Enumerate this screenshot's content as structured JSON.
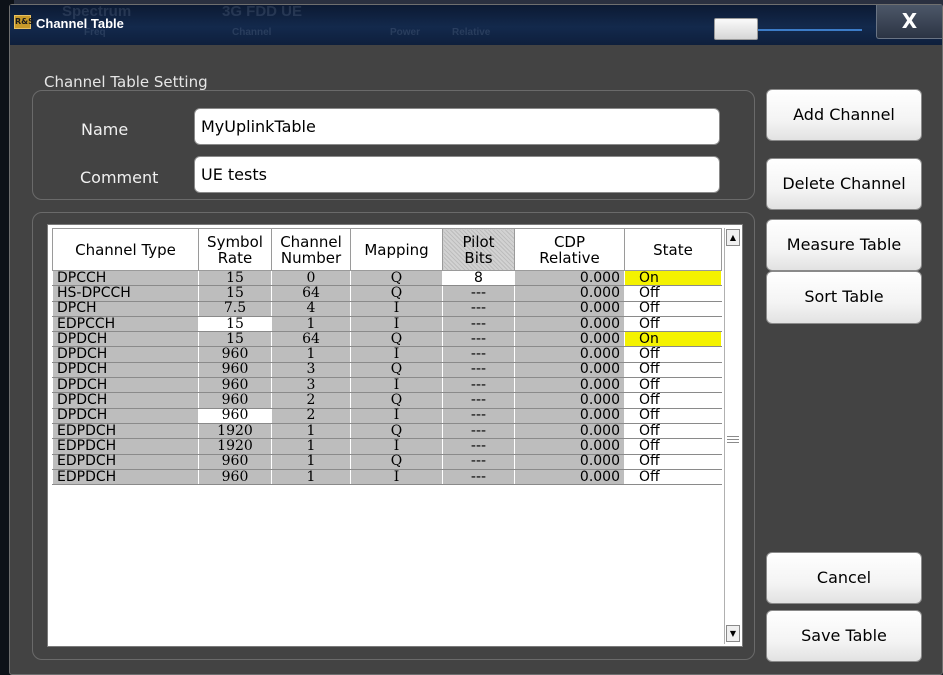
{
  "dialog": {
    "title": "Channel Table",
    "app_icon": "rs-app-icon",
    "close_label": "X",
    "background_text": [
      "Spectrum",
      "3G FDD UE",
      "Freq",
      "Channel",
      "Power",
      "Relative"
    ]
  },
  "settings": {
    "group_label": "Channel Table Setting",
    "name_label": "Name",
    "name_value": "MyUplinkTable",
    "comment_label": "Comment",
    "comment_value": "UE tests"
  },
  "table": {
    "columns": [
      [
        "Channel Type"
      ],
      [
        "Symbol",
        "Rate"
      ],
      [
        "Channel",
        "Number"
      ],
      [
        "Mapping"
      ],
      [
        "Pilot",
        "Bits"
      ],
      [
        "CDP",
        "Relative"
      ],
      [
        "State"
      ]
    ],
    "rows": [
      [
        "DPCCH",
        "15",
        "0",
        "Q",
        "8",
        "0.000",
        "On"
      ],
      [
        "HS-DPCCH",
        "15",
        "64",
        "Q",
        "---",
        "0.000",
        "Off"
      ],
      [
        "DPCH",
        "7.5",
        "4",
        "I",
        "---",
        "0.000",
        "Off"
      ],
      [
        "EDPCCH",
        "15",
        "1",
        "I",
        "---",
        "0.000",
        "Off"
      ],
      [
        "DPDCH",
        "15",
        "64",
        "Q",
        "---",
        "0.000",
        "On"
      ],
      [
        "DPDCH",
        "960",
        "1",
        "I",
        "---",
        "0.000",
        "Off"
      ],
      [
        "DPDCH",
        "960",
        "3",
        "Q",
        "---",
        "0.000",
        "Off"
      ],
      [
        "DPDCH",
        "960",
        "3",
        "I",
        "---",
        "0.000",
        "Off"
      ],
      [
        "DPDCH",
        "960",
        "2",
        "Q",
        "---",
        "0.000",
        "Off"
      ],
      [
        "DPDCH",
        "960",
        "2",
        "I",
        "---",
        "0.000",
        "Off"
      ],
      [
        "EDPDCH",
        "1920",
        "1",
        "Q",
        "---",
        "0.000",
        "Off"
      ],
      [
        "EDPDCH",
        "1920",
        "1",
        "I",
        "---",
        "0.000",
        "Off"
      ],
      [
        "EDPDCH",
        "960",
        "1",
        "Q",
        "---",
        "0.000",
        "Off"
      ],
      [
        "EDPDCH",
        "960",
        "1",
        "I",
        "---",
        "0.000",
        "Off"
      ]
    ],
    "editable_cells": [
      [
        0,
        4
      ],
      [
        3,
        1
      ],
      [
        9,
        1
      ]
    ],
    "on_color": "#f4f200"
  },
  "buttons": {
    "add_channel": "Add Channel",
    "delete_channel": "Delete Channel",
    "measure_table": "Measure Table",
    "sort_table": "Sort Table",
    "cancel": "Cancel",
    "save_table": "Save Table"
  },
  "scrollbar": {
    "up_arrow": "▲",
    "down_arrow": "▼",
    "grip_icon": "scroll-grip-icon"
  }
}
